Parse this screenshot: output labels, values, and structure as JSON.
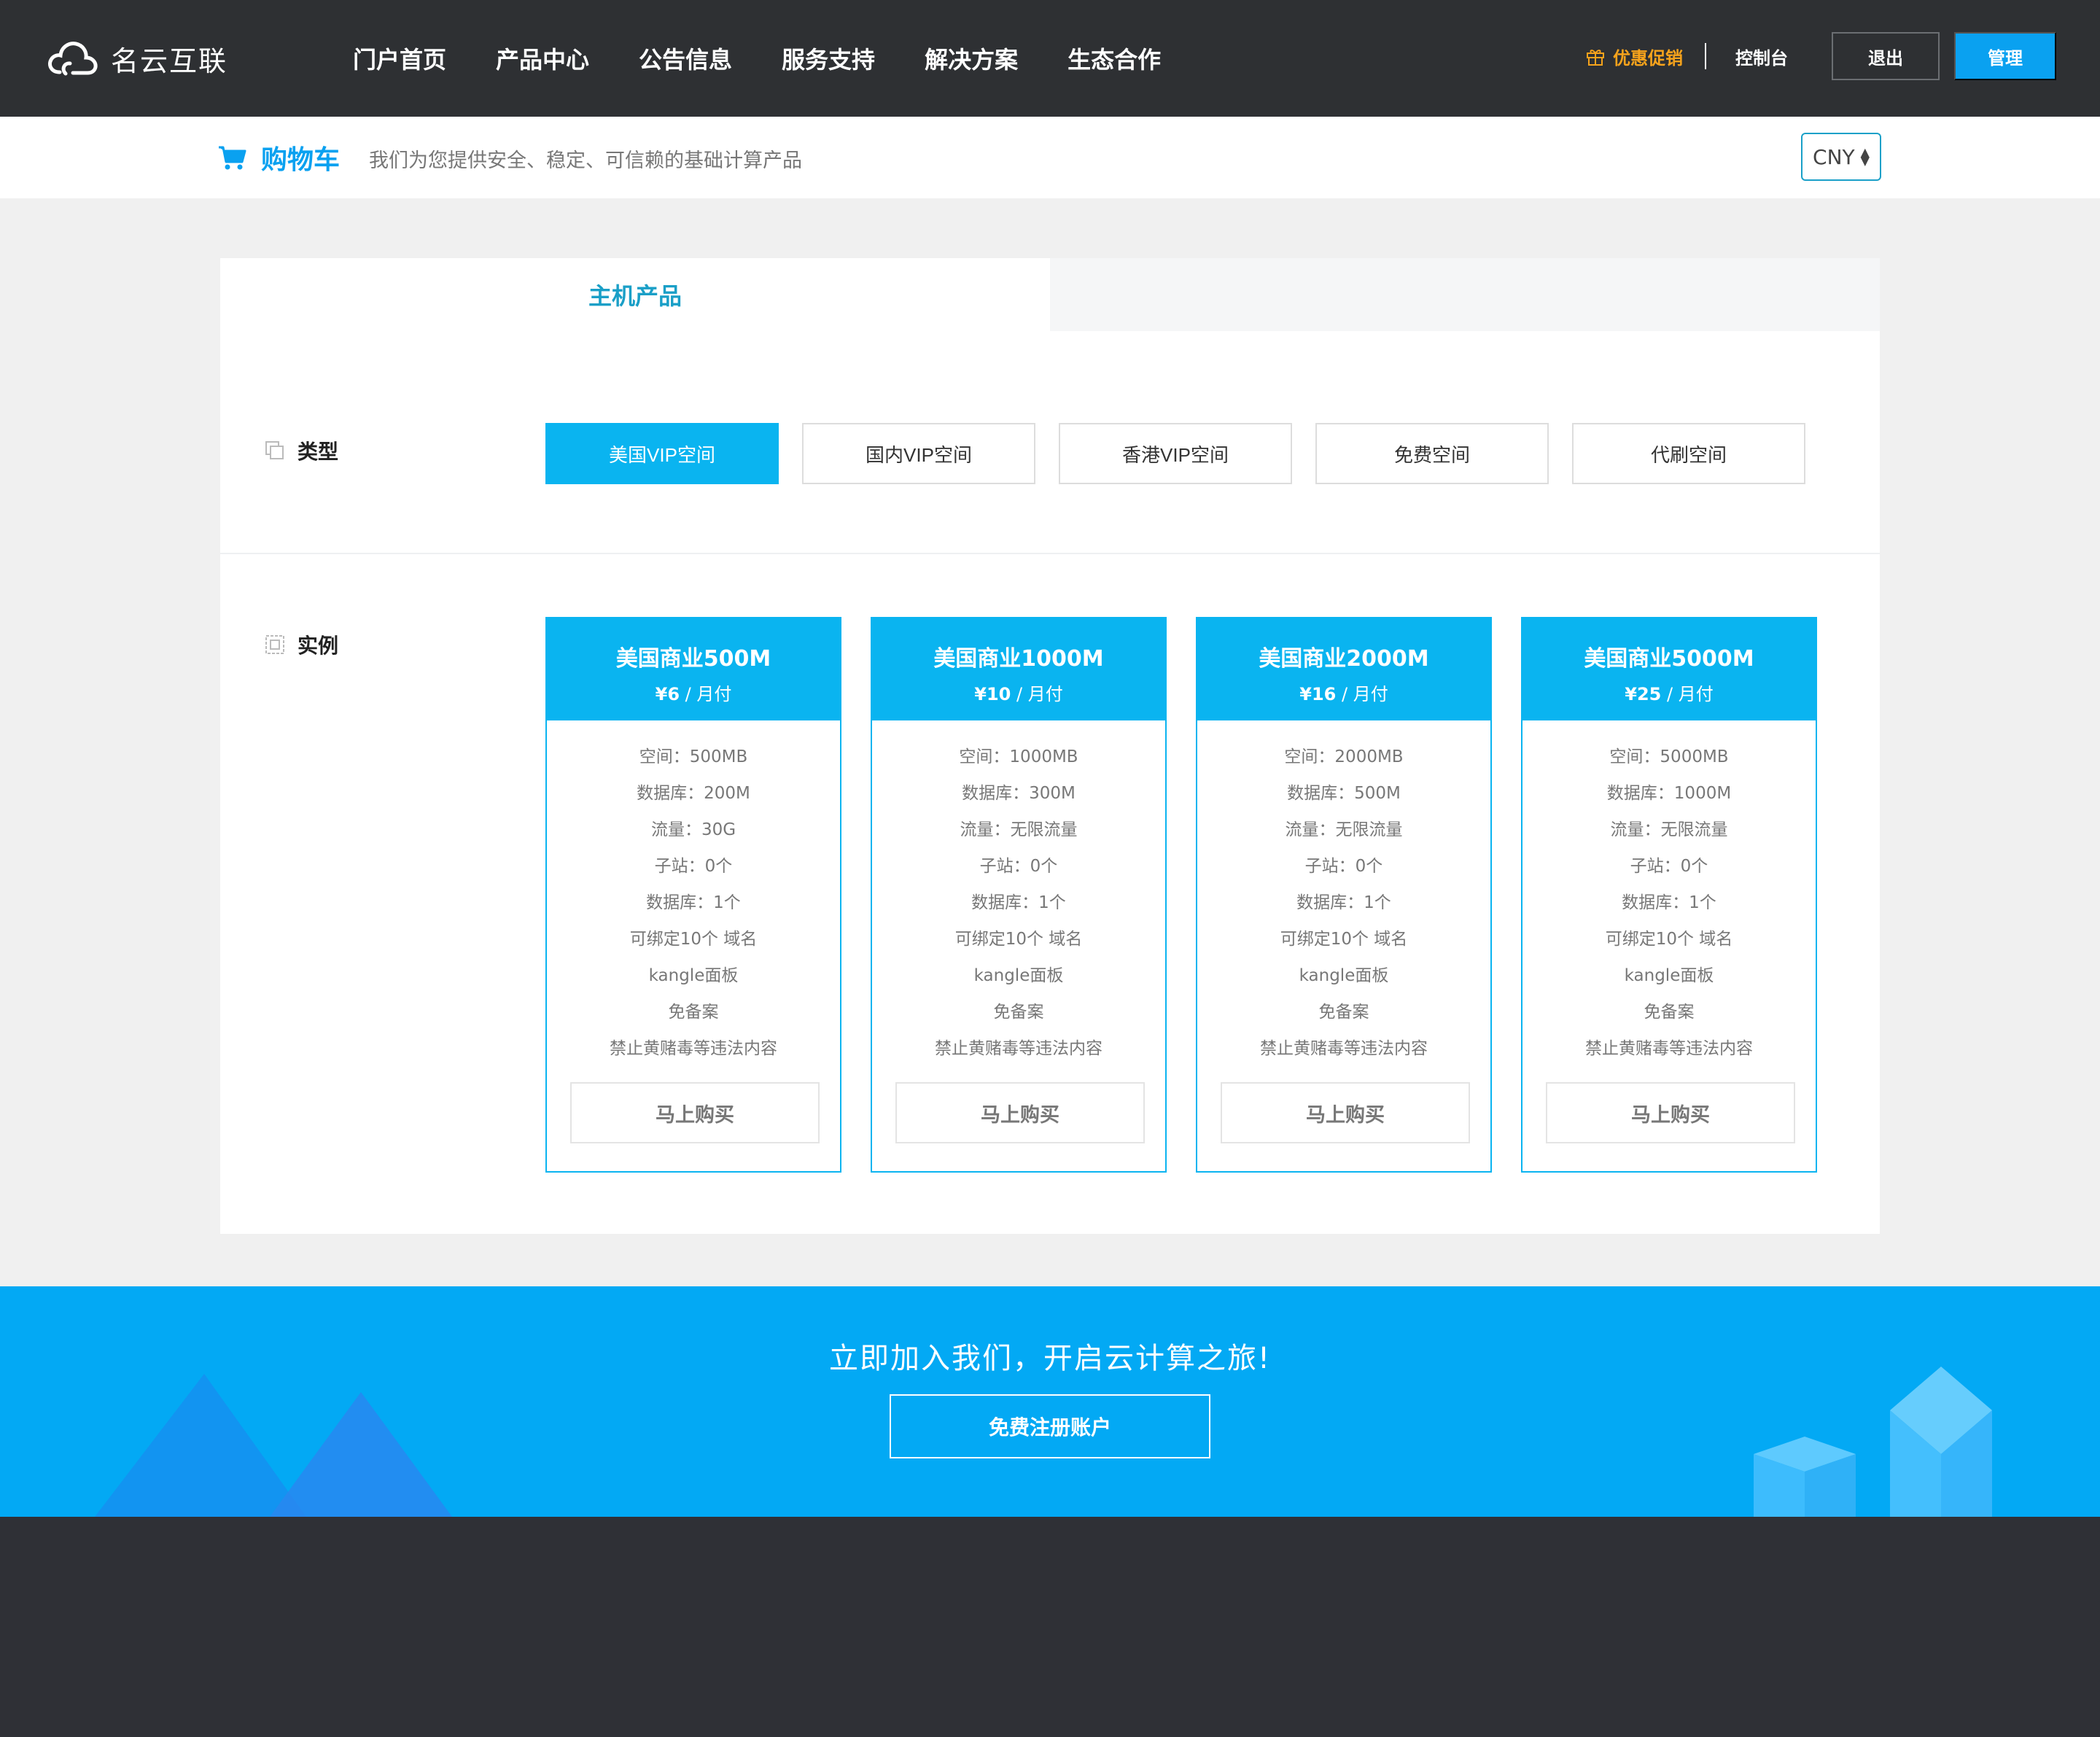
{
  "brand": {
    "name": "名云互联"
  },
  "nav": {
    "items": [
      "门户首页",
      "产品中心",
      "公告信息",
      "服务支持",
      "解决方案",
      "生态合作"
    ]
  },
  "topRight": {
    "promo": "优惠促销",
    "console": "控制台",
    "logout": "退出",
    "admin": "管理"
  },
  "cartHeader": {
    "title": "购物车",
    "subtitle": "我们为您提供安全、稳定、可信赖的基础计算产品",
    "currency": "CNY"
  },
  "tabs": {
    "active": "主机产品"
  },
  "typeSection": {
    "label": "类型",
    "options": [
      "美国VIP空间",
      "国内VIP空间",
      "香港VIP空间",
      "免费空间",
      "代刷空间"
    ],
    "selected": "美国VIP空间"
  },
  "instanceSection": {
    "label": "实例",
    "cards": [
      {
        "name": "美国商业500M",
        "price": "¥6",
        "sep": " / ",
        "period": "月付",
        "features": [
          "空间：500MB",
          "数据库：200M",
          "流量：30G",
          "子站：0个",
          "数据库：1个",
          "可绑定10个 域名",
          "kangle面板",
          "免备案",
          "禁止黄赌毒等违法内容"
        ],
        "buy": "马上购买"
      },
      {
        "name": "美国商业1000M",
        "price": "¥10",
        "sep": " / ",
        "period": "月付",
        "features": [
          "空间：1000MB",
          "数据库：300M",
          "流量：无限流量",
          "子站：0个",
          "数据库：1个",
          "可绑定10个 域名",
          "kangle面板",
          "免备案",
          "禁止黄赌毒等违法内容"
        ],
        "buy": "马上购买"
      },
      {
        "name": "美国商业2000M",
        "price": "¥16",
        "sep": " / ",
        "period": "月付",
        "features": [
          "空间：2000MB",
          "数据库：500M",
          "流量：无限流量",
          "子站：0个",
          "数据库：1个",
          "可绑定10个 域名",
          "kangle面板",
          "免备案",
          "禁止黄赌毒等违法内容"
        ],
        "buy": "马上购买"
      },
      {
        "name": "美国商业5000M",
        "price": "¥25",
        "sep": " / ",
        "period": "月付",
        "features": [
          "空间：5000MB",
          "数据库：1000M",
          "流量：无限流量",
          "子站：0个",
          "数据库：1个",
          "可绑定10个 域名",
          "kangle面板",
          "免备案",
          "禁止黄赌毒等违法内容"
        ],
        "buy": "马上购买"
      }
    ]
  },
  "banner": {
    "title": "立即加入我们，开启云计算之旅!",
    "button": "免费注册账户"
  },
  "colors": {
    "accent": "#0ab4f0",
    "promo": "#f7a31c",
    "topbar": "#2e3033",
    "banner": "#03a9f4"
  }
}
